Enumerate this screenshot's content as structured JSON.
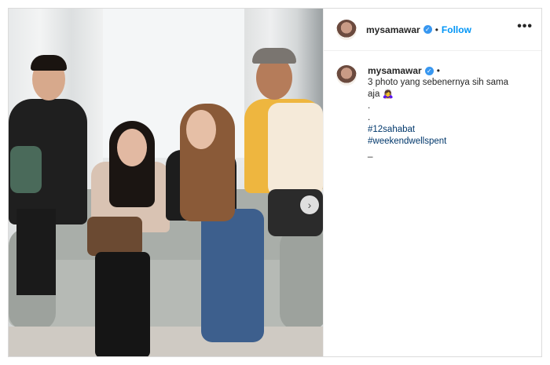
{
  "post": {
    "username": "mysamawar",
    "verified_icon": "verified-badge-icon",
    "separator": "•",
    "follow_label": "Follow",
    "more_icon": "more-options-icon",
    "more_glyph": "•••",
    "next_icon": "chevron-right-icon",
    "next_glyph": "›"
  },
  "caption": {
    "username": "mysamawar",
    "separator": "•",
    "text_line1": "3 photo yang sebenernya sih sama",
    "text_line2": "aja 🙇‍♀️",
    "dot1": ".",
    "dot2": ".",
    "hashtag1": "#12sahabat",
    "hashtag2": "#weekendwellspent",
    "tail": "_"
  },
  "colors": {
    "link_blue": "#0095f6",
    "hashtag_blue": "#00376b",
    "verified_blue": "#3897f0",
    "text": "#262626"
  }
}
